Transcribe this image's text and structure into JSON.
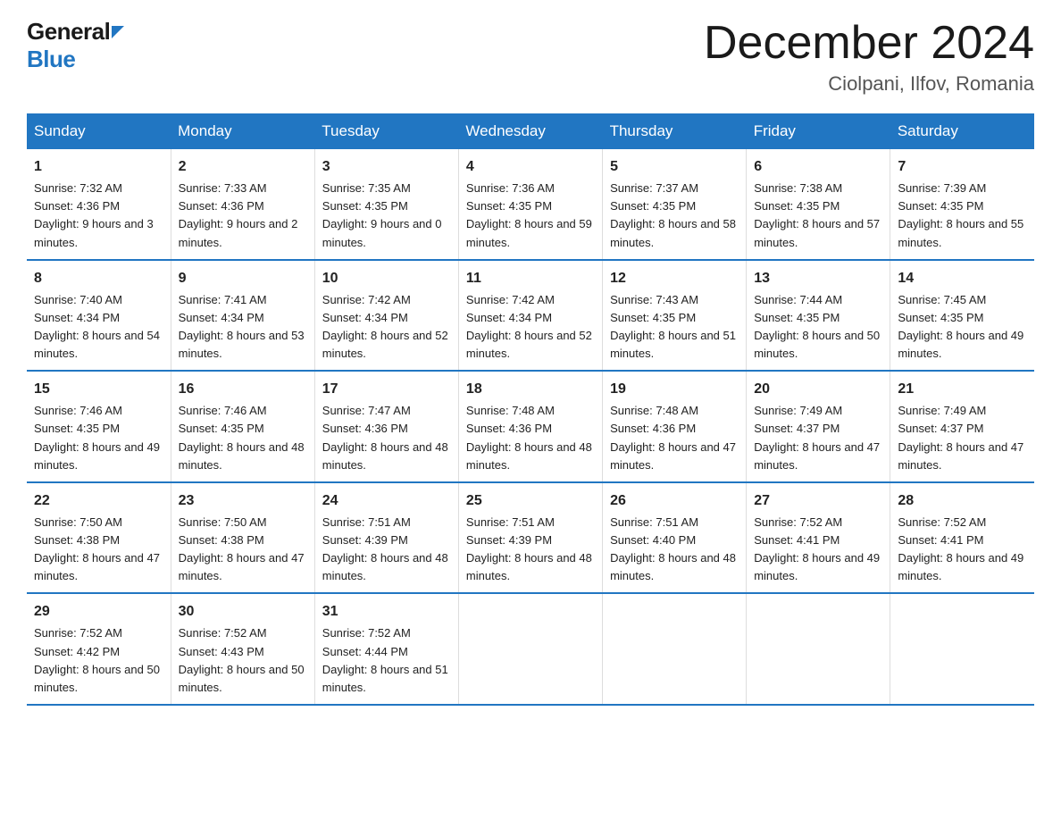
{
  "logo": {
    "general": "General",
    "blue": "Blue"
  },
  "header": {
    "title": "December 2024",
    "location": "Ciolpani, Ilfov, Romania"
  },
  "weekdays": [
    "Sunday",
    "Monday",
    "Tuesday",
    "Wednesday",
    "Thursday",
    "Friday",
    "Saturday"
  ],
  "weeks": [
    [
      {
        "day": "1",
        "sunrise": "7:32 AM",
        "sunset": "4:36 PM",
        "daylight": "9 hours and 3 minutes."
      },
      {
        "day": "2",
        "sunrise": "7:33 AM",
        "sunset": "4:36 PM",
        "daylight": "9 hours and 2 minutes."
      },
      {
        "day": "3",
        "sunrise": "7:35 AM",
        "sunset": "4:35 PM",
        "daylight": "9 hours and 0 minutes."
      },
      {
        "day": "4",
        "sunrise": "7:36 AM",
        "sunset": "4:35 PM",
        "daylight": "8 hours and 59 minutes."
      },
      {
        "day": "5",
        "sunrise": "7:37 AM",
        "sunset": "4:35 PM",
        "daylight": "8 hours and 58 minutes."
      },
      {
        "day": "6",
        "sunrise": "7:38 AM",
        "sunset": "4:35 PM",
        "daylight": "8 hours and 57 minutes."
      },
      {
        "day": "7",
        "sunrise": "7:39 AM",
        "sunset": "4:35 PM",
        "daylight": "8 hours and 55 minutes."
      }
    ],
    [
      {
        "day": "8",
        "sunrise": "7:40 AM",
        "sunset": "4:34 PM",
        "daylight": "8 hours and 54 minutes."
      },
      {
        "day": "9",
        "sunrise": "7:41 AM",
        "sunset": "4:34 PM",
        "daylight": "8 hours and 53 minutes."
      },
      {
        "day": "10",
        "sunrise": "7:42 AM",
        "sunset": "4:34 PM",
        "daylight": "8 hours and 52 minutes."
      },
      {
        "day": "11",
        "sunrise": "7:42 AM",
        "sunset": "4:34 PM",
        "daylight": "8 hours and 52 minutes."
      },
      {
        "day": "12",
        "sunrise": "7:43 AM",
        "sunset": "4:35 PM",
        "daylight": "8 hours and 51 minutes."
      },
      {
        "day": "13",
        "sunrise": "7:44 AM",
        "sunset": "4:35 PM",
        "daylight": "8 hours and 50 minutes."
      },
      {
        "day": "14",
        "sunrise": "7:45 AM",
        "sunset": "4:35 PM",
        "daylight": "8 hours and 49 minutes."
      }
    ],
    [
      {
        "day": "15",
        "sunrise": "7:46 AM",
        "sunset": "4:35 PM",
        "daylight": "8 hours and 49 minutes."
      },
      {
        "day": "16",
        "sunrise": "7:46 AM",
        "sunset": "4:35 PM",
        "daylight": "8 hours and 48 minutes."
      },
      {
        "day": "17",
        "sunrise": "7:47 AM",
        "sunset": "4:36 PM",
        "daylight": "8 hours and 48 minutes."
      },
      {
        "day": "18",
        "sunrise": "7:48 AM",
        "sunset": "4:36 PM",
        "daylight": "8 hours and 48 minutes."
      },
      {
        "day": "19",
        "sunrise": "7:48 AM",
        "sunset": "4:36 PM",
        "daylight": "8 hours and 47 minutes."
      },
      {
        "day": "20",
        "sunrise": "7:49 AM",
        "sunset": "4:37 PM",
        "daylight": "8 hours and 47 minutes."
      },
      {
        "day": "21",
        "sunrise": "7:49 AM",
        "sunset": "4:37 PM",
        "daylight": "8 hours and 47 minutes."
      }
    ],
    [
      {
        "day": "22",
        "sunrise": "7:50 AM",
        "sunset": "4:38 PM",
        "daylight": "8 hours and 47 minutes."
      },
      {
        "day": "23",
        "sunrise": "7:50 AM",
        "sunset": "4:38 PM",
        "daylight": "8 hours and 47 minutes."
      },
      {
        "day": "24",
        "sunrise": "7:51 AM",
        "sunset": "4:39 PM",
        "daylight": "8 hours and 48 minutes."
      },
      {
        "day": "25",
        "sunrise": "7:51 AM",
        "sunset": "4:39 PM",
        "daylight": "8 hours and 48 minutes."
      },
      {
        "day": "26",
        "sunrise": "7:51 AM",
        "sunset": "4:40 PM",
        "daylight": "8 hours and 48 minutes."
      },
      {
        "day": "27",
        "sunrise": "7:52 AM",
        "sunset": "4:41 PM",
        "daylight": "8 hours and 49 minutes."
      },
      {
        "day": "28",
        "sunrise": "7:52 AM",
        "sunset": "4:41 PM",
        "daylight": "8 hours and 49 minutes."
      }
    ],
    [
      {
        "day": "29",
        "sunrise": "7:52 AM",
        "sunset": "4:42 PM",
        "daylight": "8 hours and 50 minutes."
      },
      {
        "day": "30",
        "sunrise": "7:52 AM",
        "sunset": "4:43 PM",
        "daylight": "8 hours and 50 minutes."
      },
      {
        "day": "31",
        "sunrise": "7:52 AM",
        "sunset": "4:44 PM",
        "daylight": "8 hours and 51 minutes."
      },
      null,
      null,
      null,
      null
    ]
  ]
}
